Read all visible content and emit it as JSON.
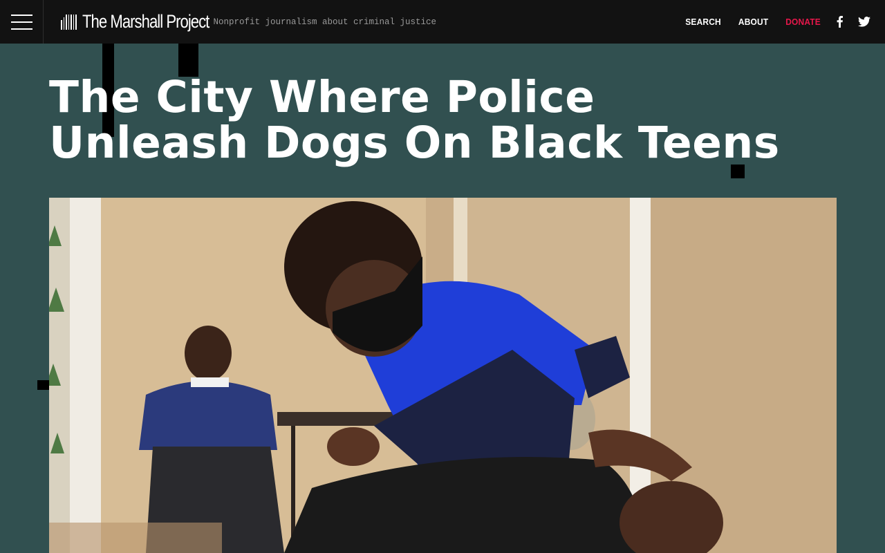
{
  "header": {
    "menu_icon": "hamburger-icon",
    "brand_name": "The Marshall Project",
    "brand_icon": "bars-logo-icon",
    "tagline": "Nonprofit journalism about criminal justice",
    "nav": {
      "search": "SEARCH",
      "about": "ABOUT",
      "donate": "DONATE"
    },
    "social": {
      "facebook_icon": "facebook-icon",
      "twitter_icon": "twitter-icon"
    }
  },
  "article": {
    "headline_line1": "The City Where Police",
    "headline_line2": "Unleash Dogs On Black Teens",
    "hero_image_description_icon": "hero-photo"
  },
  "colors": {
    "header_bg": "#121212",
    "page_bg": "#315050",
    "donate": "#e8174b",
    "text": "#ffffff"
  }
}
